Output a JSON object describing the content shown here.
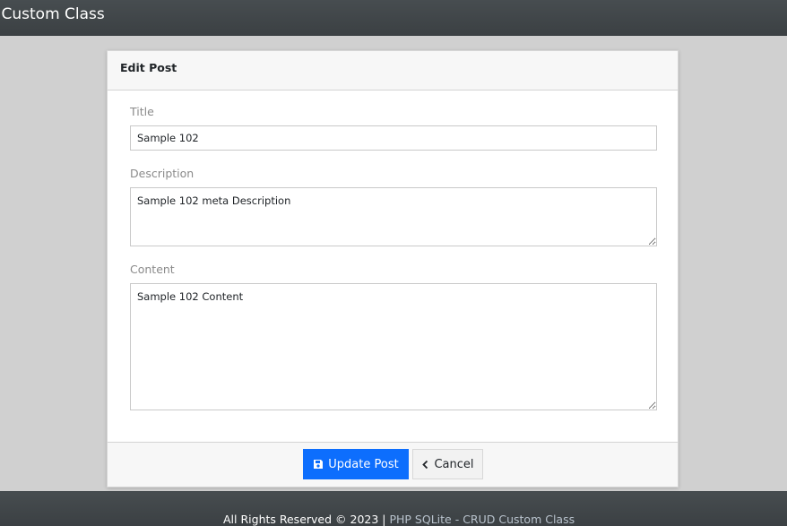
{
  "navbar": {
    "brand": "JD Custom Class"
  },
  "card": {
    "title": "Edit Post"
  },
  "form": {
    "title_label": "Title",
    "title_value": "Sample 102",
    "description_label": "Description",
    "description_value": "Sample 102 meta Description",
    "content_label": "Content",
    "content_value": "Sample 102 Content"
  },
  "buttons": {
    "update_label": "Update Post",
    "update_icon": "floppy-disk-icon",
    "cancel_label": "Cancel",
    "cancel_icon": "chevron-left-icon"
  },
  "footer": {
    "text": "All Rights Reserved © 2023 |",
    "link_text": "PHP SQLite - CRUD Custom Class"
  },
  "colors": {
    "primary": "#0d6efd",
    "navbar_bg": "#3e4346",
    "page_bg": "#d0d0d0"
  }
}
